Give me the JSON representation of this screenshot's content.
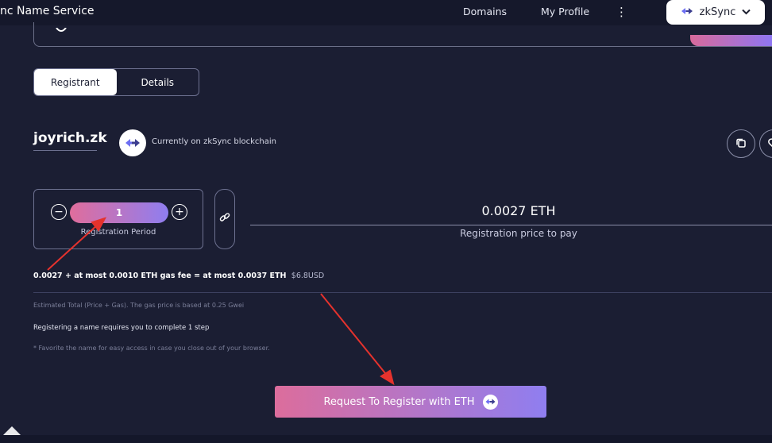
{
  "header": {
    "brand": "nc Name Service",
    "nav": {
      "domains": "Domains",
      "my_profile": "My Profile"
    },
    "network": {
      "label": "zkSync",
      "icon": "zksync-arrows-icon",
      "dropdown_icon": "chevron-down-icon"
    }
  },
  "tabs": [
    {
      "label": "Registrant",
      "active": true
    },
    {
      "label": "Details",
      "active": false
    }
  ],
  "domain": {
    "name": "joyrich.zk",
    "chain_text": "Currently on zkSync blockchain"
  },
  "registration": {
    "period_value": "1",
    "period_label": "Registration Period",
    "price": "0.0027 ETH",
    "price_label": "Registration price to pay"
  },
  "fees": {
    "summary": "0.0027 + at most 0.0010 ETH gas fee = at most 0.0037 ETH",
    "usd": "$6.8USD"
  },
  "notes": {
    "estimated": "Estimated Total (Price + Gas). The gas price is based at 0.25 Gwei",
    "steps": "Registering a name requires you to complete 1 step",
    "favorite": "* Favorite the name for easy access in case you close out of your browser."
  },
  "cta": {
    "label": "Request To Register with ETH"
  },
  "colors": {
    "background": "#1b1e33",
    "accent_start": "#dc6d9c",
    "accent_end": "#8f7ef0",
    "annotation": "#e5322d"
  }
}
